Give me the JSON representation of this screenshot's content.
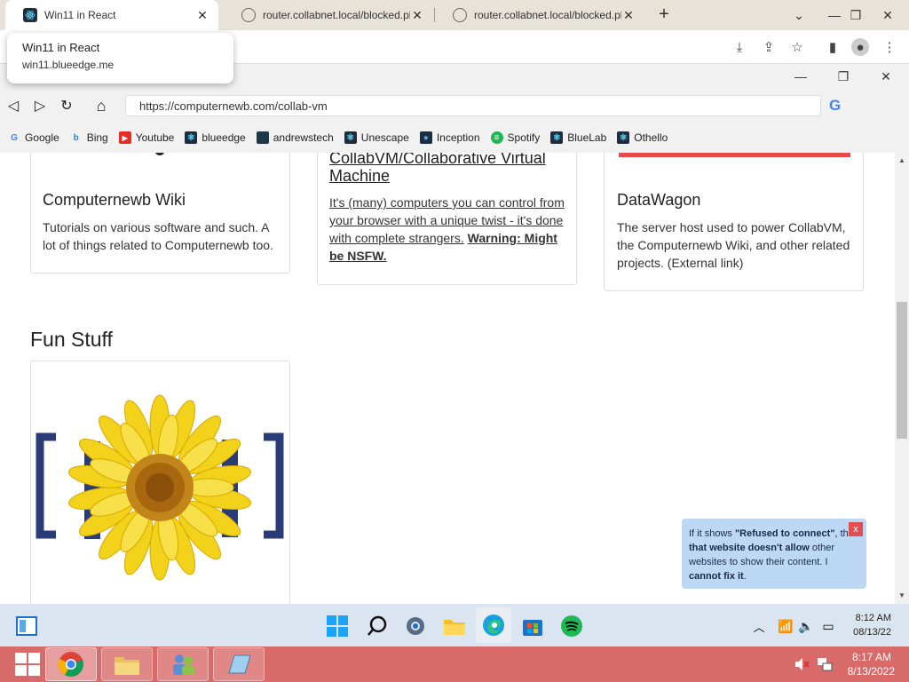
{
  "outer_browser": {
    "tabs": [
      {
        "title": "Win11 in React",
        "active": true
      },
      {
        "title": "router.collabnet.local/blocked.ph",
        "active": false
      },
      {
        "title": "router.collabnet.local/blocked.ph",
        "active": false
      }
    ],
    "new_tab_symbol": "+",
    "tooltip": {
      "title": "Win11 in React",
      "url": "win11.blueedge.me"
    }
  },
  "inner_browser": {
    "url": "https://computernewb.com/collab-vm",
    "bookmarks": [
      {
        "label": "Google",
        "icon": "google-icon"
      },
      {
        "label": "Bing",
        "icon": "bing-icon"
      },
      {
        "label": "Youtube",
        "icon": "youtube-icon"
      },
      {
        "label": "blueedge",
        "icon": "react-icon"
      },
      {
        "label": "andrewstech",
        "icon": "andrewstech-icon"
      },
      {
        "label": "Unescape",
        "icon": "react-icon"
      },
      {
        "label": "Inception",
        "icon": "inception-icon"
      },
      {
        "label": "Spotify",
        "icon": "spotify-icon"
      },
      {
        "label": "BlueLab",
        "icon": "bluelab-icon"
      },
      {
        "label": "Othello",
        "icon": "othello-icon"
      }
    ]
  },
  "page": {
    "cards": [
      {
        "title": "Computernewb Wiki",
        "desc": "Tutorials on various software and such. A lot of things related to Computernewb too."
      },
      {
        "title": "CollabVM/Collaborative Virtual Machine",
        "desc": "It's (many) computers you can control from your browser with a unique twist - it's done with complete strangers.",
        "warning": "Warning: Might be NSFW."
      },
      {
        "title": "DataWagon",
        "desc": "The server host used to power CollabVM, the Computernewb Wiki, and other related projects. (External link)"
      }
    ],
    "section_heading": "Fun Stuff",
    "notice": {
      "p1": "If it shows ",
      "b1": "\"Refused to connect\"",
      "p2": ", then ",
      "b2": "that website doesn't allow",
      "p3": " other websites to show their content. I ",
      "b3": "cannot fix it",
      "p4": ".",
      "close": "x"
    }
  },
  "win11_taskbar": {
    "time": "8:12 AM",
    "date": "08/13/22"
  },
  "win7_taskbar": {
    "time": "8:17 AM",
    "date": "8/13/2022"
  },
  "colors": {
    "outer_tabstrip": "#e8e3d8",
    "datawagon_banner": "#e84a4a",
    "win7_taskbar": "#d96a6a",
    "win11_taskbar": "#dbe5f1",
    "notice_bg": "#bcd8f4"
  }
}
